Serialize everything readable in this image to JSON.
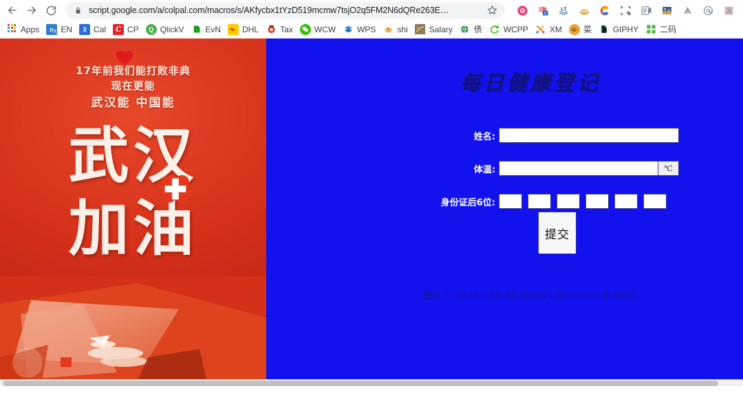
{
  "browser": {
    "back_icon": "back-arrow-icon",
    "forward_icon": "forward-arrow-icon",
    "reload_icon": "reload-icon",
    "lock_icon": "lock-icon",
    "url": "script.google.com/a/colpal.com/macros/s/AKfycbx1tYzD519mcmw7tsjO2q5FM2N6dQRe263E…",
    "star_icon": "bookmark-star-icon",
    "extensions": [
      {
        "name": "pocket-extension-icon",
        "color": "#ef3e79"
      },
      {
        "name": "translate-extension-icon",
        "color": "#f28b82",
        "badge": "2"
      },
      {
        "name": "languagetool-extension-icon",
        "color": "#2b5797"
      },
      {
        "name": "honey-extension-icon",
        "color": "#d9a441"
      },
      {
        "name": "camtasia-extension-icon",
        "color": "#e84a33"
      },
      {
        "name": "screenshot-extension-icon",
        "color": "#4a4a4a"
      },
      {
        "name": "notes-extension-icon",
        "color": "#7f8c8d"
      },
      {
        "name": "image-extension-icon",
        "color": "#3a6ea5"
      },
      {
        "name": "drive-extension-icon",
        "color": "#9aa0a6"
      },
      {
        "name": "mail-extension-icon",
        "color": "#7f8c8d"
      },
      {
        "name": "acrobat-extension-icon",
        "color": "#b0a0a0"
      }
    ]
  },
  "bookmarks": [
    {
      "label": "Apps",
      "icon": "apps-grid-icon",
      "color": "#4285f4"
    },
    {
      "label": "EN",
      "icon": "english-dictionary-icon",
      "color": "#2f7fd0"
    },
    {
      "label": "Cal",
      "icon": "calendar-icon",
      "color": "#2a6fd6",
      "glyph": "3"
    },
    {
      "label": "CP",
      "icon": "colgate-icon",
      "color": "#e3242b",
      "glyph": "C"
    },
    {
      "label": "QlickV",
      "icon": "qlikview-icon",
      "color": "#4caf50",
      "glyph": "Q"
    },
    {
      "label": "EvN",
      "icon": "evernote-icon",
      "color": "#1aa01a"
    },
    {
      "label": "DHL",
      "icon": "dhl-icon",
      "color": "#ffcc00"
    },
    {
      "label": "Tax",
      "icon": "tax-icon",
      "color": "#c0392b"
    },
    {
      "label": "WCW",
      "icon": "wechat-web-icon",
      "color": "#2dc100"
    },
    {
      "label": "WPS",
      "icon": "wps-icon",
      "color": "#3a7bd5"
    },
    {
      "label": "shi",
      "icon": "shi-money-icon",
      "color": "#e8a33d"
    },
    {
      "label": "Salary",
      "icon": "salary-icon",
      "color": "#8c7b5a"
    },
    {
      "label": "债",
      "icon": "globe-icon",
      "color": "#2f8f4e"
    },
    {
      "label": "WCPP",
      "icon": "wechat-pay-icon",
      "color": "#2dc100"
    },
    {
      "label": "XM",
      "icon": "xm-scissors-icon",
      "color": "#e2574c"
    },
    {
      "label": "菜",
      "icon": "cainiao-icon",
      "color": "#f0a030"
    },
    {
      "label": "GIPHY",
      "icon": "giphy-icon",
      "color": "#1a1a1a"
    },
    {
      "label": "二码",
      "icon": "qrcode-icon",
      "color": "#55b847"
    }
  ],
  "poster": {
    "headline_line1": "17年前我们能打败非典",
    "headline_line2": "现在更能",
    "headline_line3": "武汉能 中国能",
    "big_line1": "武汉",
    "big_line2": "加油",
    "heart_icon": "heart-icon",
    "cross_icon": "medical-cross-icon",
    "bg_color": "#d4301a"
  },
  "form": {
    "title": "每日健康登记",
    "panel_color": "#1212ef",
    "fields": [
      {
        "label": "姓名:",
        "value": "",
        "placeholder": ""
      },
      {
        "label": "体温:",
        "value": "",
        "placeholder": "",
        "unit": "℃"
      },
      {
        "label": "身份证后6位:",
        "boxes": [
          "",
          "",
          "",
          "",
          "",
          ""
        ]
      }
    ],
    "submit_label": "提交",
    "footer": "版权 © 2020 CSX All Rights Reserved 京华宇虹"
  }
}
